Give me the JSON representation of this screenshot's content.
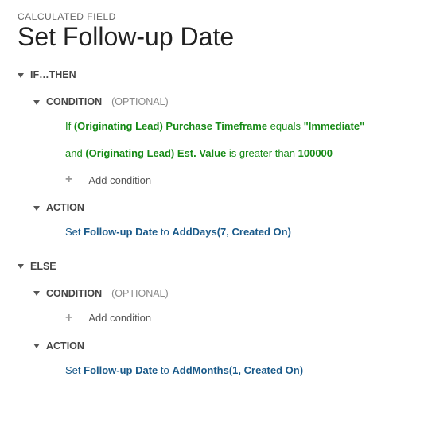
{
  "breadcrumb": "CALCULATED FIELD",
  "title": "Set Follow-up Date",
  "labels": {
    "if_then": "IF…THEN",
    "else": "ELSE",
    "condition": "CONDITION",
    "optional": "(OPTIONAL)",
    "action": "ACTION",
    "add_condition": "Add condition"
  },
  "if_block": {
    "cond1": {
      "prefix": "If ",
      "field": "(Originating Lead) Purchase Timeframe",
      "op": " equals ",
      "value": "\"Immediate\""
    },
    "cond2": {
      "prefix": "and ",
      "field": "(Originating Lead) Est. Value",
      "op": " is greater than ",
      "value": "100000"
    },
    "action": {
      "prefix": "Set ",
      "field": "Follow-up Date",
      "mid": " to ",
      "func": "AddDays(7, Created On)"
    }
  },
  "else_block": {
    "action": {
      "prefix": "Set ",
      "field": "Follow-up Date",
      "mid": " to ",
      "func": "AddMonths(1, Created On)"
    }
  }
}
